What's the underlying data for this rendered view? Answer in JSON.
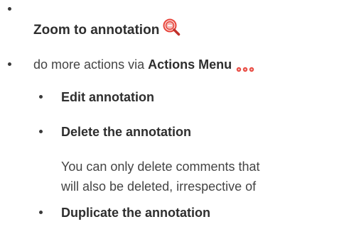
{
  "items": {
    "zoom": {
      "label": "Zoom to annotation",
      "icon": "zoom-magnifier-icon"
    },
    "actions": {
      "prefix": "do more actions via ",
      "menu_label": "Actions Menu",
      "icon": "ellipsis-dots-icon"
    },
    "sub_items": [
      {
        "label": "Edit annotation"
      },
      {
        "label": "Delete the annotation"
      },
      {
        "label": "Duplicate the annotation"
      }
    ],
    "delete_note": {
      "line1": "You can only delete comments that",
      "line2": "will also be deleted, irrespective of"
    }
  },
  "colors": {
    "text": "#3a3a3a",
    "icon_red": "#e8453c",
    "icon_pink": "#f4b6b3"
  }
}
